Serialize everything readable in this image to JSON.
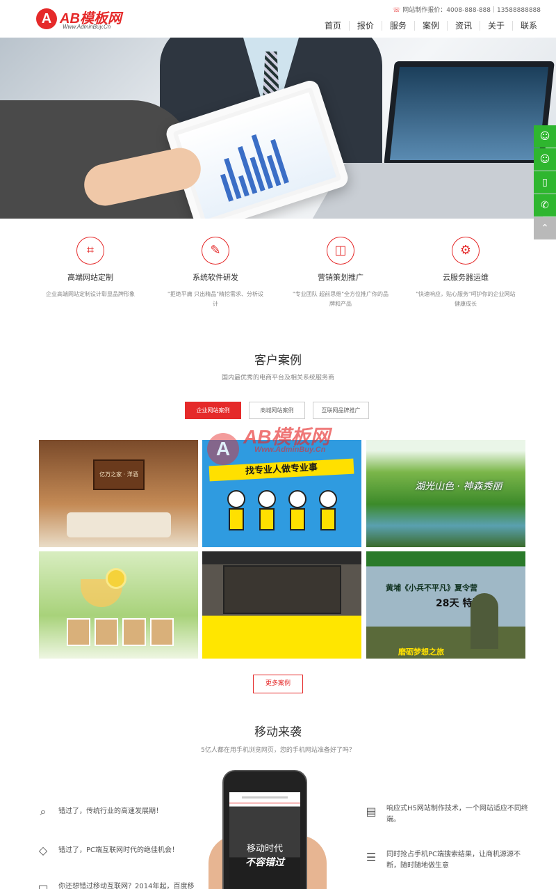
{
  "header": {
    "logo_mark": "A",
    "logo_text": "AB模板网",
    "logo_sub": "Www.AdminBuy.Cn",
    "hotline": "网站制作报价：4008-888-888｜13588888888",
    "nav": [
      "首页",
      "报价",
      "服务",
      "案例",
      "资讯",
      "关于",
      "联系"
    ]
  },
  "side_float": {
    "buttons": [
      "qq-icon",
      "qq-icon",
      "mobile-icon",
      "phone-icon",
      "back-to-top-icon"
    ]
  },
  "services": [
    {
      "icon": "web-design-icon",
      "title": "高端网站定制",
      "desc": "企业高端网站定制设计彰显品牌形象"
    },
    {
      "icon": "pen-icon",
      "title": "系统软件研发",
      "desc": "\"拒绝平庸 只出精品\"精挖需求、分析设计"
    },
    {
      "icon": "bag-icon",
      "title": "营销策划推广",
      "desc": "\"专业团队 超前思维\"全方位推广你的品牌和产品"
    },
    {
      "icon": "gear-icon",
      "title": "云服务器运维",
      "desc": "\"快速响应，贴心服务\"呵护你的企业网站健康成长"
    }
  ],
  "cases": {
    "title": "客户案例",
    "subtitle": "国内最优秀的电商平台及相关系统服务商",
    "tabs": [
      "企业网站案例",
      "商城网站案例",
      "互联网品牌推广"
    ],
    "active_tab": 0,
    "items": [
      {
        "text": "亿万之家 · 洋酒"
      },
      {
        "text": "找专业人做专业事"
      },
      {
        "text": "湖光山色 · 神森秀丽"
      },
      {
        "text": ""
      },
      {
        "text": ""
      },
      {
        "text": "黄埔《小兵不平凡》夏令营",
        "big": "28天 特训班",
        "foot": "磨砺梦想之旅"
      }
    ],
    "watermark": {
      "mark": "A",
      "text": "AB模板网",
      "sub": "Www.AdminBuy.Cn"
    },
    "more_label": "更多案例"
  },
  "mobile": {
    "title": "移动来袭",
    "subtitle": "5亿人都在用手机浏览网页，您的手机网站准备好了吗？",
    "phone_line1": "移动时代",
    "phone_line2": "不容错过",
    "left_features": [
      {
        "icon": "search-icon",
        "text": "错过了，传统行业的高速发展期！"
      },
      {
        "icon": "diamond-icon",
        "text": "错过了，PC端互联网时代的绝佳机会！"
      },
      {
        "icon": "monitor-icon",
        "text": "你还想错过移动互联网？2014年起，百度移"
      }
    ],
    "right_features": [
      {
        "icon": "responsive-icon",
        "text": "响应式H5网站制作技术，一个网站适应不同终端。"
      },
      {
        "icon": "list-icon",
        "text": "同时抢占手机PC端搜索结果，让商机源源不断，随时随地做生意"
      }
    ]
  }
}
